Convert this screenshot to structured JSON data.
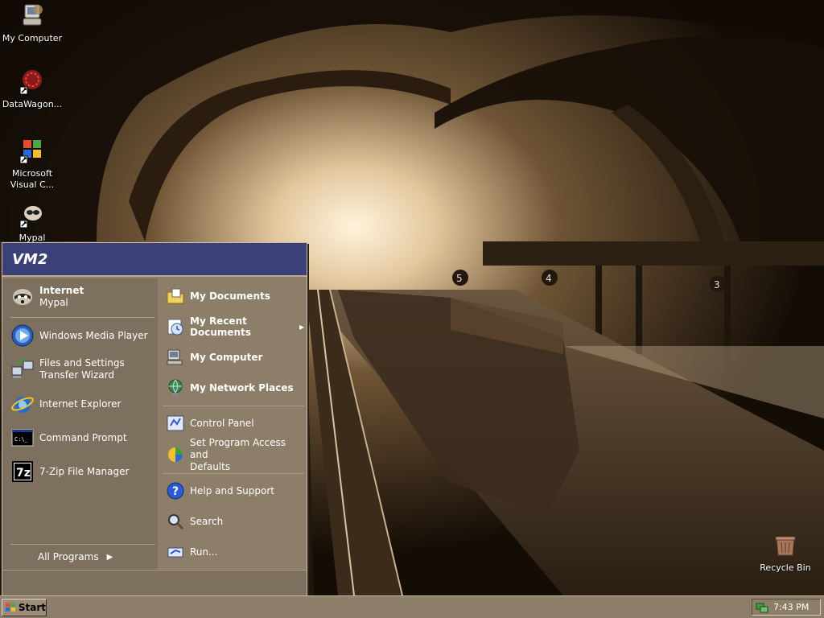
{
  "desktop": {
    "icons": [
      {
        "label": "My Computer",
        "icon": "my-computer-icon"
      },
      {
        "label": "DataWagon...",
        "icon": "datawagon-shortcut-icon"
      },
      {
        "label": "Microsoft\nVisual C...",
        "icon": "visual-c-shortcut-icon"
      },
      {
        "label": "Mypal",
        "icon": "mypal-shortcut-icon"
      },
      {
        "label": "Recycle Bin",
        "icon": "recycle-bin-icon"
      }
    ]
  },
  "start_menu": {
    "user": "VM2",
    "left": {
      "pinned": {
        "title": "Internet",
        "subtitle": "Mypal",
        "icon": "mypal-raccoon-icon"
      },
      "recent": [
        {
          "label": "Windows Media Player",
          "icon": "media-player-icon"
        },
        {
          "label": "Files and Settings\nTransfer Wizard",
          "icon": "transfer-wizard-icon"
        },
        {
          "label": "Internet Explorer",
          "icon": "internet-explorer-icon"
        },
        {
          "label": "Command Prompt",
          "icon": "command-prompt-icon"
        },
        {
          "label": "7-Zip File Manager",
          "icon": "7zip-icon"
        }
      ],
      "all_programs": "All Programs"
    },
    "right": {
      "places": [
        {
          "label": "My Documents",
          "icon": "my-documents-icon"
        },
        {
          "label": "My Recent Documents",
          "icon": "recent-documents-icon",
          "arrow": "▸"
        },
        {
          "label": "My Computer",
          "icon": "my-computer-icon"
        },
        {
          "label": "My Network Places",
          "icon": "network-places-icon"
        }
      ],
      "settings": [
        {
          "label": "Control Panel",
          "icon": "control-panel-icon"
        },
        {
          "label": "Set Program Access and\nDefaults",
          "icon": "program-access-icon"
        }
      ],
      "tools": [
        {
          "label": "Help and Support",
          "icon": "help-icon"
        },
        {
          "label": "Search",
          "icon": "search-icon"
        },
        {
          "label": "Run...",
          "icon": "run-icon"
        }
      ]
    }
  },
  "taskbar": {
    "start_label": "Start",
    "clock": "7:43 PM"
  },
  "colors": {
    "header": "#3b4178",
    "menu_bg": "#8d7e6a",
    "taskbar": "#8d7e6a"
  }
}
